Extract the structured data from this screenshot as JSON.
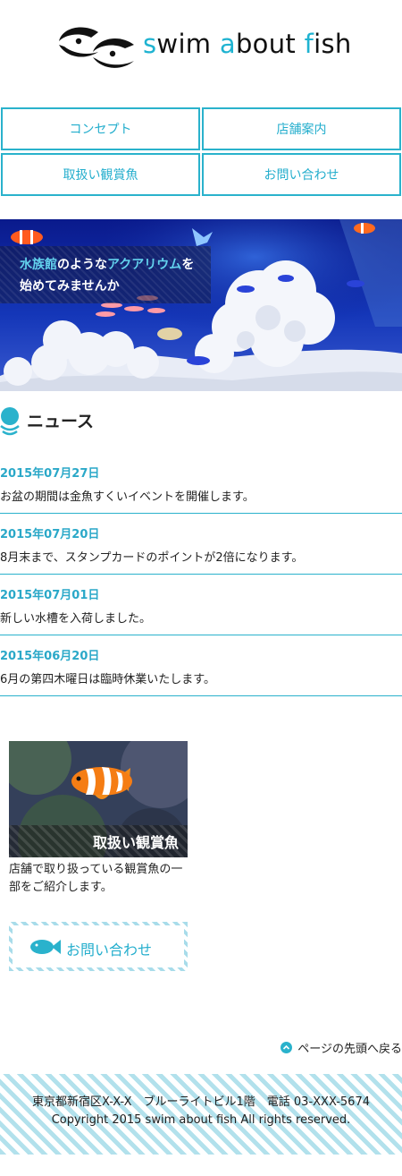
{
  "logo": {
    "text_parts": [
      "s",
      "wim ",
      "a",
      "bout ",
      "f",
      "ish"
    ],
    "brand_color": "#1fb3d1"
  },
  "nav": {
    "items": [
      {
        "label": "コンセプト"
      },
      {
        "label": "店舗案内"
      },
      {
        "label": "取扱い観賞魚"
      },
      {
        "label": "お問い合わせ"
      }
    ],
    "border_color": "#2ab2cc"
  },
  "hero": {
    "line1": [
      {
        "text": "水族館",
        "highlight": true
      },
      {
        "text": "のような",
        "highlight": false
      },
      {
        "text": "アクアリウム",
        "highlight": true
      },
      {
        "text": "を",
        "highlight": false
      }
    ],
    "line2": "始めてみませんか"
  },
  "news": {
    "title": "ニュース",
    "items": [
      {
        "date": "2015年07月27日",
        "text": "お盆の期間は金魚すくいイベントを開催します。"
      },
      {
        "date": "2015年07月20日",
        "text": "8月末まで、スタンプカードのポイントが2倍になります。"
      },
      {
        "date": "2015年07月01日",
        "text": "新しい水槽を入荷しました。"
      },
      {
        "date": "2015年06月20日",
        "text": "6月の第四木曜日は臨時休業いたします。"
      }
    ]
  },
  "card": {
    "label": "取扱い観賞魚",
    "description": "店舗で取り扱っている観賞魚の一部をご紹介します。"
  },
  "contact": {
    "label": "お問い合わせ"
  },
  "pagetop": {
    "label": "ページの先頭へ戻る"
  },
  "footer": {
    "address": "東京都新宿区X-X-X　ブルーライトビル1階　電話 03-XXX-5674",
    "copyright": "Copyright 2015 swim about fish All rights reserved."
  }
}
